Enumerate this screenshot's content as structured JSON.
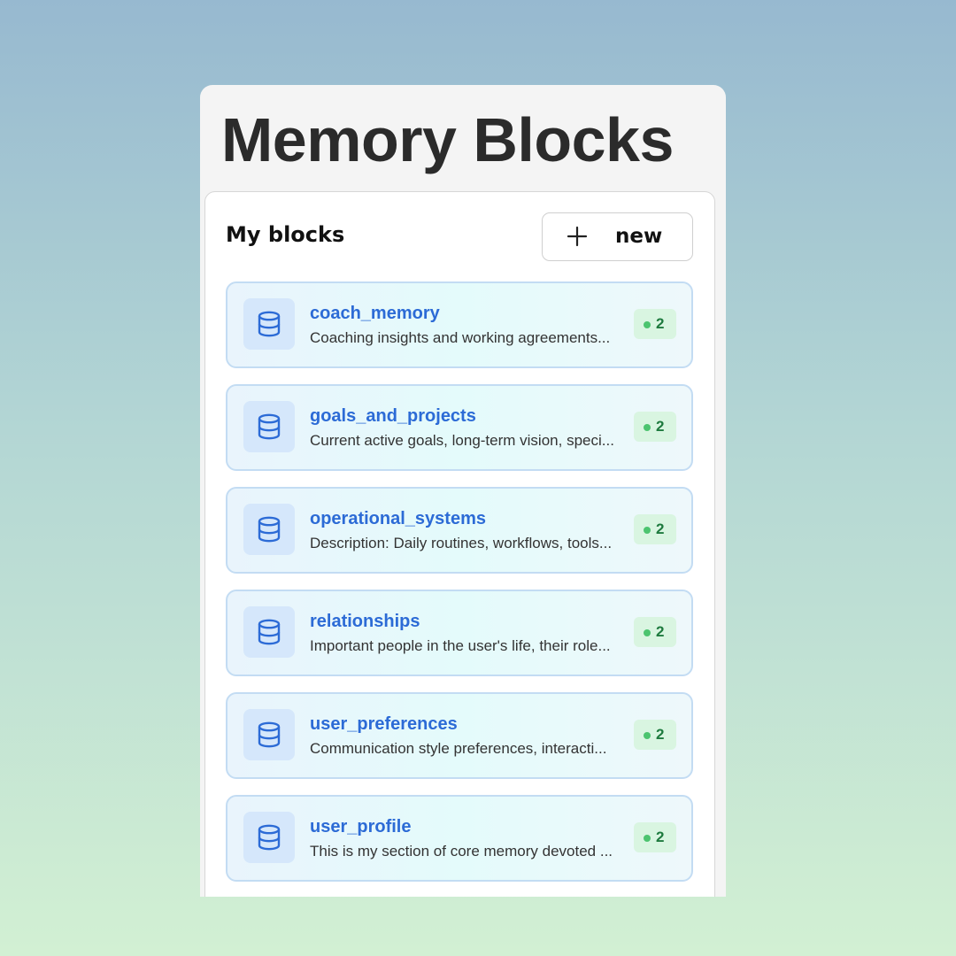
{
  "panel": {
    "title": "Memory Blocks"
  },
  "card": {
    "header_title": "My blocks",
    "new_button": {
      "label": "new",
      "icon": "plus-icon"
    }
  },
  "blocks": [
    {
      "name": "coach_memory",
      "description": "Coaching insights and working agreements...",
      "count": "2",
      "icon": "database-icon"
    },
    {
      "name": "goals_and_projects",
      "description": "Current active goals, long-term vision, speci...",
      "count": "2",
      "icon": "database-icon"
    },
    {
      "name": "operational_systems",
      "description": "Description: Daily routines, workflows, tools...",
      "count": "2",
      "icon": "database-icon"
    },
    {
      "name": "relationships",
      "description": "Important people in the user's life, their role...",
      "count": "2",
      "icon": "database-icon"
    },
    {
      "name": "user_preferences",
      "description": "Communication style preferences, interacti...",
      "count": "2",
      "icon": "database-icon"
    },
    {
      "name": "user_profile",
      "description": "This is my section of core memory devoted ...",
      "count": "2",
      "icon": "database-icon"
    }
  ],
  "colors": {
    "accent": "#2c6bd6",
    "badge_bg": "#d9f5e1",
    "badge_dot": "#4cc46f",
    "badge_text": "#1e7a3e",
    "item_border": "#c3dcf3"
  }
}
